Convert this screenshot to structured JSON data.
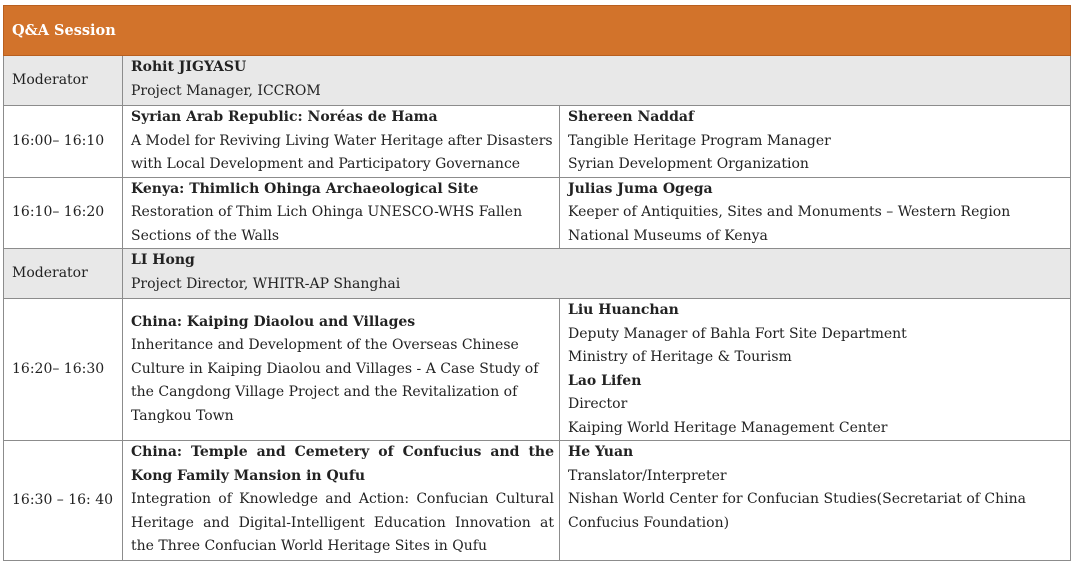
{
  "header": {
    "title": "Q&A Session"
  },
  "moderator1": {
    "label": "Moderator",
    "name": "Rohit JIGYASU",
    "role": "Project Manager, ICCROM"
  },
  "talk1": {
    "time": "16:00– 16:10",
    "title": "Syrian Arab Republic: Noréas de Hama",
    "desc": "A Model for Reviving Living Water Heritage after Disasters with Local Development and Participatory Governance",
    "speaker": {
      "name": "Shereen Naddaf",
      "role": "Tangible Heritage Program Manager",
      "org": "Syrian Development Organization"
    }
  },
  "talk2": {
    "time": "16:10– 16:20",
    "title": "Kenya: Thimlich Ohinga Archaeological Site",
    "desc": "Restoration of Thim Lich Ohinga UNESCO-WHS Fallen Sections of the Walls",
    "speaker": {
      "name": "Julias Juma Ogega",
      "role": "Keeper of Antiquities, Sites and Monuments – Western Region",
      "org": "National Museums of Kenya"
    }
  },
  "moderator2": {
    "label": "Moderator",
    "name": "LI Hong",
    "role": "Project Director, WHITR-AP Shanghai"
  },
  "talk3": {
    "time": "16:20– 16:30",
    "title": "China: Kaiping Diaolou and Villages",
    "desc": "Inheritance and Development of the Overseas Chinese Culture in Kaiping Diaolou and Villages - A Case Study of the Cangdong Village Project and the Revitalization of Tangkou Town",
    "speaker1": {
      "name": "Liu Huanchan",
      "role": "Deputy Manager of Bahla Fort Site Department",
      "org": "Ministry of Heritage & Tourism"
    },
    "speaker2": {
      "name": "Lao Lifen",
      "role": "Director",
      "org": "Kaiping World Heritage Management Center"
    }
  },
  "talk4": {
    "time": "16:30 – 16: 40",
    "title": "China: Temple and Cemetery of Confucius and the Kong Family Mansion in Qufu",
    "desc": "Integration of Knowledge and Action: Confucian Cultural Heritage and Digital-Intelligent Education Innovation at the Three Confucian World Heritage Sites in Qufu",
    "speaker": {
      "name": "He Yuan",
      "role": "Translator/Interpreter",
      "org": "Nishan World Center for Confucian Studies(Secretariat of China Confucius Foundation)"
    }
  }
}
